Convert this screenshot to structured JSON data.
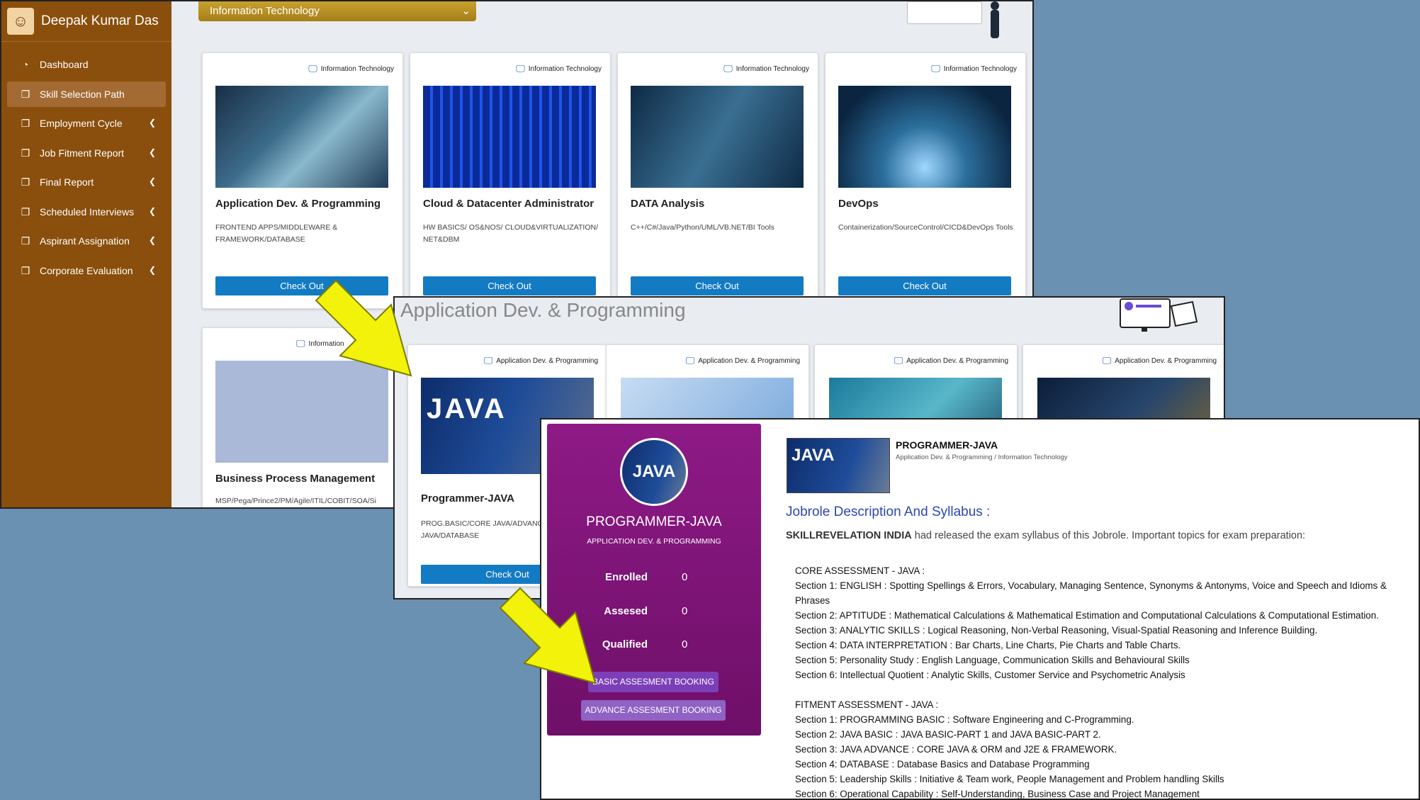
{
  "sidebar": {
    "user_name": "Deepak Kumar Das",
    "items": [
      {
        "label": "Dashboard",
        "icon": "dashboard-icon"
      },
      {
        "label": "Skill Selection Path",
        "icon": "copy-icon"
      },
      {
        "label": "Employment Cycle",
        "icon": "copy-icon"
      },
      {
        "label": "Job Fitment Report",
        "icon": "copy-icon"
      },
      {
        "label": "Final Report",
        "icon": "copy-icon"
      },
      {
        "label": "Scheduled Interviews",
        "icon": "copy-icon"
      },
      {
        "label": "Aspirant Assignation",
        "icon": "copy-icon"
      },
      {
        "label": "Corporate Evaluation",
        "icon": "copy-icon"
      }
    ]
  },
  "domain_select": {
    "value": "Information Technology"
  },
  "skill_cards": [
    {
      "category": "Information Technology",
      "title": "Application Dev. & Programming",
      "desc": "FRONTEND APPS/MIDDLEWARE & FRAMEWORK/DATABASE",
      "button": "Check Out"
    },
    {
      "category": "Information Technology",
      "title": "Cloud & Datacenter Administrator",
      "desc": "HW BASICS/ OS&NOS/ CLOUD&VIRTUALIZATION/ NET&DBM",
      "button": "Check Out"
    },
    {
      "category": "Information Technology",
      "title": "DATA Analysis",
      "desc": "C++/C#/Java/Python/UML/VB.NET/BI Tools",
      "button": "Check Out"
    },
    {
      "category": "Information Technology",
      "title": "DevOps",
      "desc": "Containerization/SourceControl/CICD&DevOps Tools",
      "button": "Check Out"
    },
    {
      "category": "Information",
      "title": "Business Process Management",
      "desc": "MSP/Pega/Prince2/PM/Agile/ITIL/COBIT/SOA/Si"
    }
  ],
  "appdev": {
    "title": "Application Dev. & Programming",
    "cards": [
      {
        "category": "Application Dev. & Programming",
        "image_text": "JAVA",
        "title": "Programmer-JAVA",
        "desc": "PROG.BASIC/CORE JAVA/ADVANCE JAVA/DATABASE",
        "button": "Check Out"
      },
      {
        "category": "Application Dev. & Programming"
      },
      {
        "category": "Application Dev. & Programming"
      },
      {
        "category": "Application Dev. & Programming"
      }
    ]
  },
  "jobrole": {
    "avatar_text": "JAVA",
    "name": "PROGRAMMER-JAVA",
    "category": "APPLICATION DEV. & PROGRAMMING",
    "stats": [
      {
        "label": "Enrolled",
        "value": "0"
      },
      {
        "label": "Assesed",
        "value": "0"
      },
      {
        "label": "Qualified",
        "value": "0"
      }
    ],
    "basic_button": "BASIC ASSESMENT BOOKING",
    "advance_button": "ADVANCE ASSESMENT BOOKING",
    "thumb_text": "JAVA",
    "header_title": "PROGRAMMER-JAVA",
    "header_path": "Application Dev. & Programming / Information Technology",
    "syllabus_heading": "Jobrole Description And Syllabus :",
    "intro_org": "SKILLREVELATION INDIA",
    "intro_rest": " had released the exam syllabus of this Jobrole. Important topics for exam preparation:",
    "core_title": "CORE ASSESSMENT - JAVA :",
    "core_sections": [
      "Section 1: ENGLISH :  Spotting Spellings & Errors, Vocabulary, Managing Sentence, Synonyms  & Antonyms, Voice and Speech and Idioms &",
      "Phrases",
      "Section 2: APTITUDE :  Mathematical Calculations & Mathematical Estimation and Computational Calculations & Computational Estimation.",
      "Section 3: ANALYTIC SKILLS :  Logical Reasoning, Non-Verbal Reasoning, Visual-Spatial Reasoning and Inference Building.",
      "Section 4: DATA INTERPRETATION : Bar Charts, Line Charts, Pie Charts and Table Charts.",
      "Section 5: Personality Study : English Language, Communication Skills and Behavioural Skills",
      "Section 6: Intellectual Quotient : Analytic Skills, Customer Service and Psychometric Analysis"
    ],
    "fitment_title": "FITMENT ASSESSMENT - JAVA :",
    "fitment_sections": [
      "Section 1: PROGRAMMING BASIC : Software Engineering and C-Programming.",
      "Section 2: JAVA BASIC : JAVA BASIC-PART 1 and JAVA BASIC-PART 2.",
      "Section 3: JAVA ADVANCE : CORE JAVA & ORM and J2E & FRAMEWORK.",
      "Section 4:  DATABASE : Database Basics and Database Programming",
      "Section 5: Leadership Skills : Initiative & Team work, People Management and Problem handling Skills",
      "Section 6: Operational Capability : Self-Understanding, Business Case and Project Management"
    ]
  },
  "colors": {
    "sidebar": "#8a4f0c",
    "button_blue": "#137bc3",
    "jobrole_panel": "#8e1a86",
    "heading_blue": "#2948b5",
    "arrow_yellow": "#f2f20a",
    "background": "#6a90b2"
  }
}
